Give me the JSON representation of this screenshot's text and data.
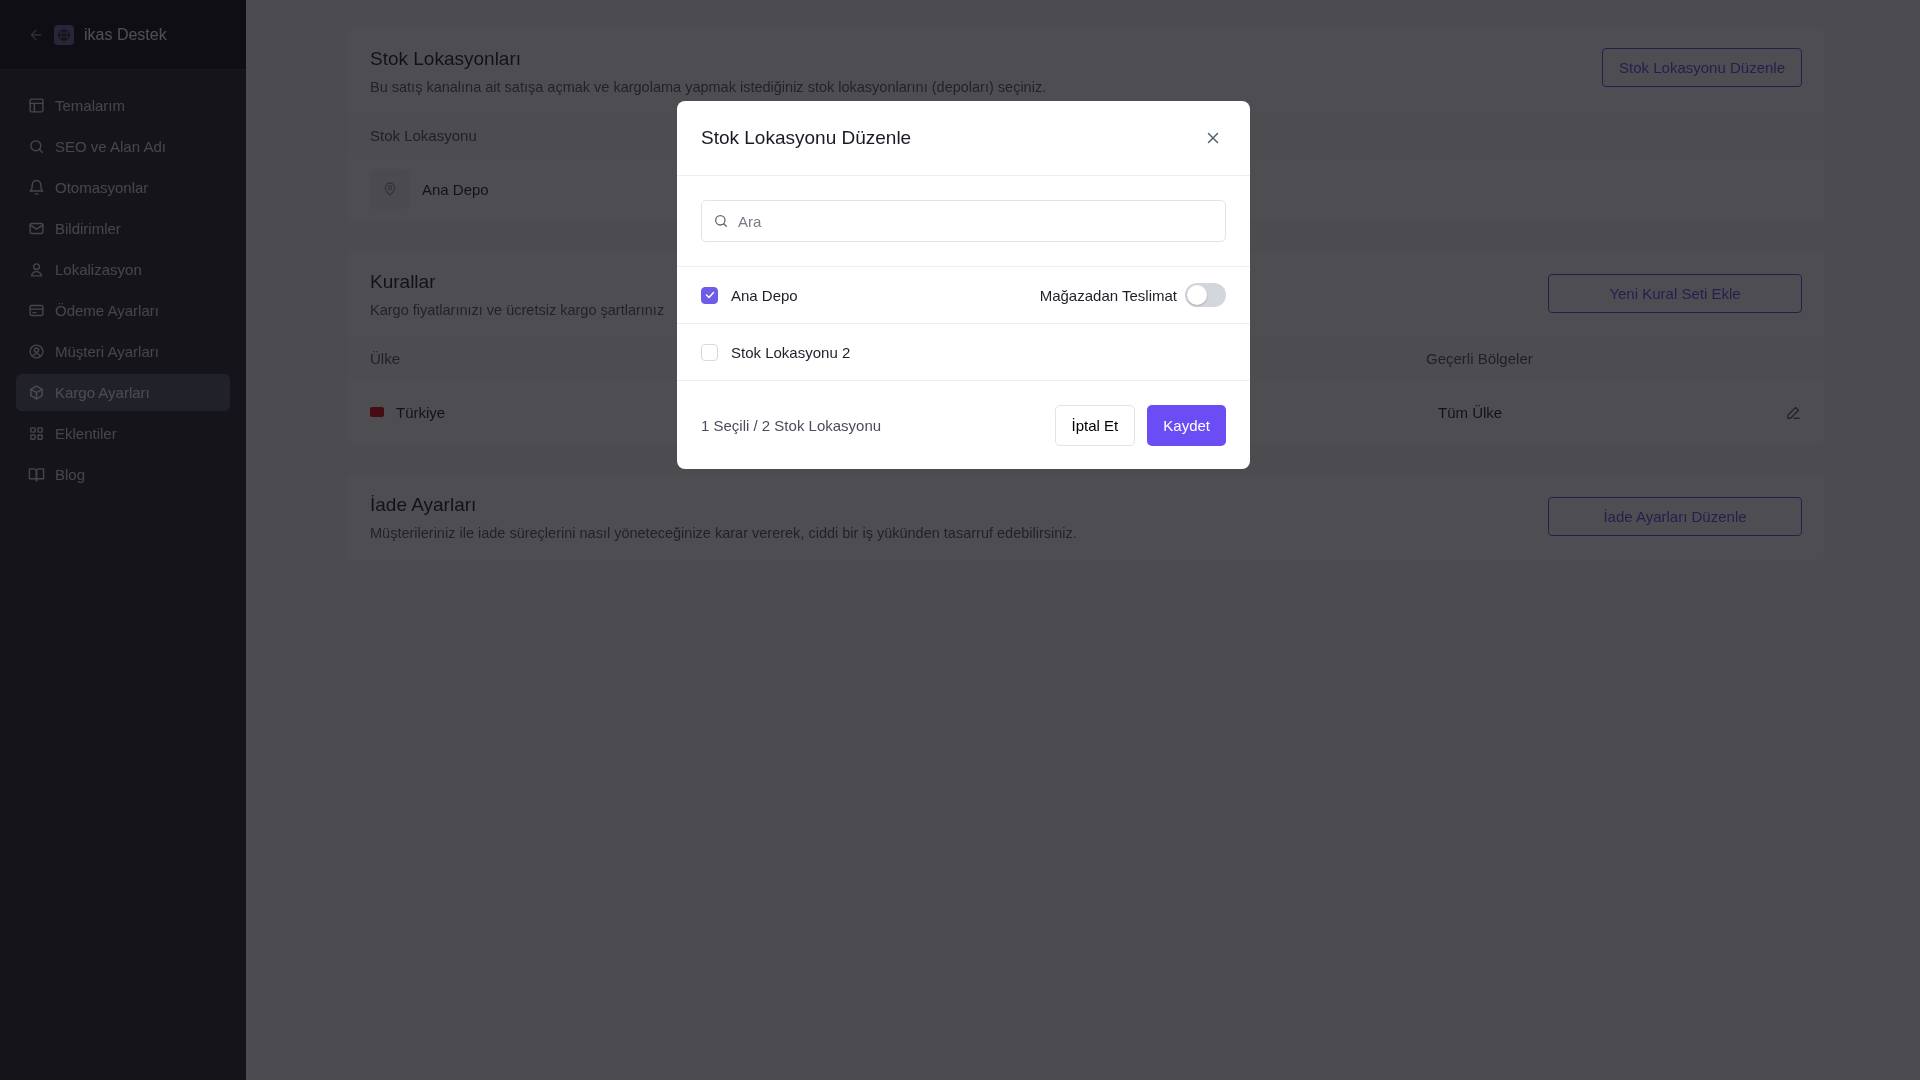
{
  "sidebar": {
    "brand": "ikas Destek",
    "items": [
      {
        "label": "Temalarım",
        "selected": false
      },
      {
        "label": "SEO ve Alan Adı",
        "selected": false
      },
      {
        "label": "Otomasyonlar",
        "selected": false
      },
      {
        "label": "Bildirimler",
        "selected": false
      },
      {
        "label": "Lokalizasyon",
        "selected": false
      },
      {
        "label": "Ödeme Ayarları",
        "selected": false
      },
      {
        "label": "Müşteri Ayarları",
        "selected": false
      },
      {
        "label": "Kargo Ayarları",
        "selected": true
      },
      {
        "label": "Eklentiler",
        "selected": false
      },
      {
        "label": "Blog",
        "selected": false
      }
    ]
  },
  "stock_section": {
    "title": "Stok Lokasyonları",
    "description": "Bu satış kanalına ait satışa açmak ve kargolama yapmak istediğiniz stok lokasyonlarını (depoları) seçiniz.",
    "button": "Stok Lokasyonu Düzenle",
    "column": "Stok Lokasyonu",
    "rows": [
      "Ana Depo"
    ]
  },
  "rules_section": {
    "title": "Kurallar",
    "description": "Kargo fiyatlarınızı ve ücretsiz kargo şartlarınız",
    "button": "Yeni Kural Seti Ekle",
    "columns": [
      "Ülke",
      "Geçerli Bölgeler"
    ],
    "rows": [
      {
        "country": "Türkiye",
        "regions": "Tüm Ülke"
      }
    ]
  },
  "returns_section": {
    "title": "İade Ayarları",
    "description": "Müşterileriniz ile iade süreçlerini nasıl yöneteceğinize karar vererek, ciddi bir iş yükünden tasarruf edebilirsiniz.",
    "button": "İade Ayarları Düzenle"
  },
  "modal": {
    "title": "Stok Lokasyonu Düzenle",
    "search": {
      "placeholder": "Ara"
    },
    "locations": [
      {
        "name": "Ana Depo",
        "checked": true,
        "store_delivery": {
          "label": "Mağazadan Teslimat",
          "on": false
        }
      },
      {
        "name": "Stok Lokasyonu 2",
        "checked": false
      }
    ],
    "summary": "1 Seçili / 2 Stok Lokasyonu",
    "cancel": "İptal Et",
    "save": "Kaydet"
  }
}
